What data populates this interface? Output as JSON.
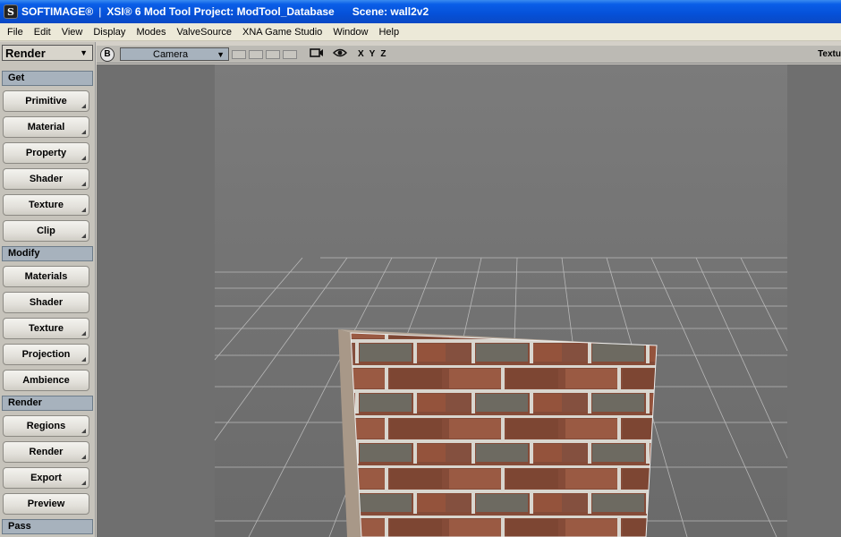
{
  "titlebar": {
    "app_icon": "softimage-logo-icon",
    "app_name": "SOFTIMAGE®",
    "separator": "|",
    "project": "XSI® 6 Mod Tool Project: ModTool_Database",
    "scene": "Scene: wall2v2"
  },
  "menu": [
    "File",
    "Edit",
    "View",
    "Display",
    "Modes",
    "ValveSource",
    "XNA Game Studio",
    "Window",
    "Help"
  ],
  "panel": {
    "mode": "Render",
    "sections": [
      {
        "title": "Get",
        "buttons": [
          "Primitive",
          "Material",
          "Property",
          "Shader",
          "Texture",
          "Clip"
        ]
      },
      {
        "title": "Modify",
        "buttons": [
          "Materials",
          "Shader",
          "Texture",
          "Projection",
          "Ambience"
        ]
      },
      {
        "title": "Render",
        "buttons": [
          "Regions",
          "Render",
          "Export",
          "Preview"
        ]
      },
      {
        "title": "Pass",
        "buttons": []
      }
    ]
  },
  "viewport": {
    "b_label": "B",
    "camera": "Camera",
    "axes": [
      "X",
      "Y",
      "Z"
    ],
    "display_mode": "Textu",
    "icons": [
      "camera-icon",
      "eye-icon"
    ],
    "colors": {
      "background": "#6f6f6f",
      "grid": "#cfcfcf",
      "brick": "#8a4f3a",
      "mortar": "#d9d6cf"
    }
  }
}
